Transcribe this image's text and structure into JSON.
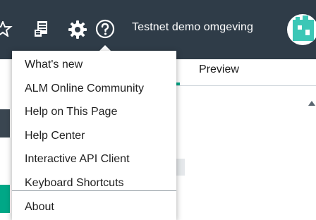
{
  "header": {
    "environment_title": "Testnet demo omgeving",
    "icons": [
      "star-icon",
      "clipboard-icon",
      "gear-icon",
      "help-icon"
    ],
    "background": "#2f3c48"
  },
  "main": {
    "tab_label": "Preview"
  },
  "help_menu": {
    "items": [
      {
        "label": "What's new"
      },
      {
        "label": "ALM Online Community"
      },
      {
        "label": "Help on This Page"
      },
      {
        "label": "Help Center"
      },
      {
        "label": "Interactive API Client"
      },
      {
        "label": "Keyboard Shortcuts"
      },
      {
        "label": "About"
      }
    ]
  },
  "colors": {
    "accent": "#00a887",
    "topbar": "#2f3c48",
    "avatar": "#3cc7b6"
  }
}
